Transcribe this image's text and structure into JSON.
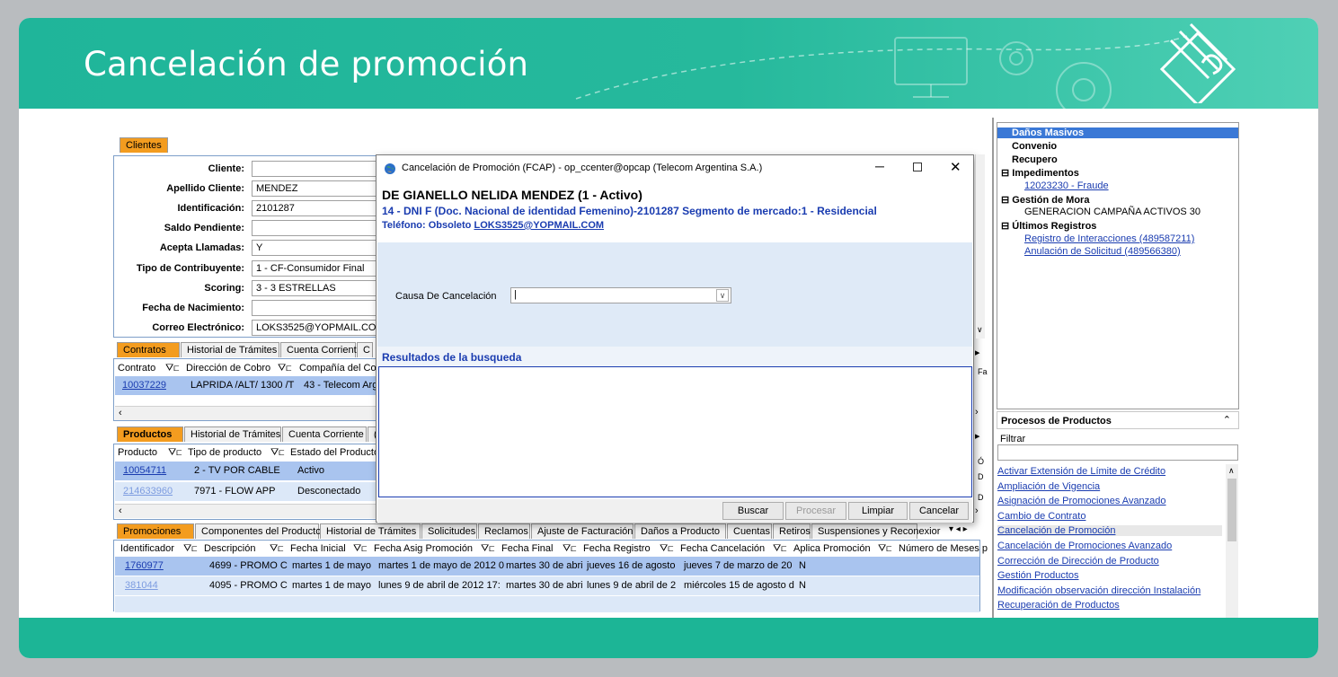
{
  "slide": {
    "title": "Cancelación de promoción"
  },
  "clientes_tab": "Clientes",
  "client_fields": [
    {
      "label": "Cliente:",
      "value": ""
    },
    {
      "label": "Apellido Cliente:",
      "value": "MENDEZ"
    },
    {
      "label": "Identificación:",
      "value": "2101287"
    },
    {
      "label": "Saldo Pendiente:",
      "value": ""
    },
    {
      "label": "Acepta Llamadas:",
      "value": "Y"
    },
    {
      "label": "Tipo de Contribuyente:",
      "value": "1 - CF-Consumidor Final"
    },
    {
      "label": "Scoring:",
      "value": "3 - 3 ESTRELLAS"
    },
    {
      "label": "Fecha de Nacimiento:",
      "value": ""
    },
    {
      "label": "Correo Electrónico:",
      "value": "LOKS3525@YOPMAIL.COM"
    }
  ],
  "contratos": {
    "tabs": [
      "Contratos",
      "Historial de Trámites",
      "Cuenta Corriente",
      "C"
    ],
    "headers": [
      "Contrato",
      "Dirección de Cobro",
      "Compañía del Cont"
    ],
    "row": {
      "contrato": "10037229",
      "direccion": "LAPRIDA /ALT/ 1300 /T",
      "compania": "43 - Telecom Arg"
    }
  },
  "productos": {
    "tabs": [
      "Productos",
      "Historial de Trámites",
      "Cuenta Corriente",
      "("
    ],
    "headers": [
      "Producto",
      "Tipo de producto",
      "Estado del Producto"
    ],
    "rows": [
      {
        "id": "10054711",
        "tipo": "2 - TV POR CABLE",
        "estado": "Activo"
      },
      {
        "id": "214633960",
        "tipo": "7971 - FLOW APP",
        "estado": "Desconectado"
      }
    ]
  },
  "promociones": {
    "tabs": [
      "Promociones",
      "Componentes del Producto",
      "Historial de Trámites",
      "Solicitudes",
      "Reclamos",
      "Ajuste de Facturación",
      "Daños a Producto",
      "Cuentas",
      "Retiros",
      "Suspensiones y Reconexior"
    ],
    "headers": [
      "Identificador",
      "Descripción",
      "Fecha Inicial",
      "Fecha Asig Promoción",
      "Fecha Final",
      "Fecha Registro",
      "Fecha Cancelación",
      "Aplica Promoción",
      "Número de Meses p"
    ],
    "rows": [
      {
        "id": "1760977",
        "desc": "4699 - PROMO C",
        "inicial": "martes 1 de mayo",
        "asig": "martes 1 de mayo de 2012 0",
        "final": "martes 30 de abri",
        "registro": "jueves 16 de agosto",
        "cancel": "jueves 7 de marzo de 20",
        "aplica": "N"
      },
      {
        "id": "381044",
        "desc": "4095 - PROMO C",
        "inicial": "martes 1 de mayo",
        "asig": "lunes 9 de abril de 2012 17:",
        "final": "martes 30 de abri",
        "registro": "lunes 9 de abril de 2",
        "cancel": "miércoles 15 de agosto d",
        "aplica": "N"
      }
    ]
  },
  "right_panel": {
    "items": [
      {
        "text": "Daños Masivos",
        "type": "selected"
      },
      {
        "text": "Convenio",
        "type": "bold"
      },
      {
        "text": "Recupero",
        "type": "bold"
      },
      {
        "text": "Impedimentos",
        "type": "group"
      },
      {
        "text": "12023230 - Fraude",
        "type": "link"
      },
      {
        "text": "Gestión de Mora",
        "type": "group"
      },
      {
        "text": "GENERACION CAMPAÑA ACTIVOS 30",
        "type": "plain"
      },
      {
        "text": "Últimos Registros",
        "type": "group"
      },
      {
        "text": "Registro de Interacciones (489587211)",
        "type": "link"
      },
      {
        "text": "Anulación de Solicitud (489566380)",
        "type": "link"
      }
    ],
    "procesos_title": "Procesos de Productos",
    "filtrar_label": "Filtrar",
    "procesos": [
      "Activar Extensión de Límite de Crédito",
      "Ampliación de Vigencia",
      "Asignación de Promociones Avanzado",
      "Cambio de Contrato",
      "Cancelación de Promoción",
      "Cancelación de Promociones Avanzado",
      "Corrección de Dirección de Producto",
      "Gestión Productos",
      "Modificación observación dirección Instalación",
      "Recuperación de Productos"
    ]
  },
  "dialog": {
    "title": "Cancelación de Promoción (FCAP) - op_ccenter@opcap (Telecom Argentina S.A.)",
    "customer_name": "DE GIANELLO NELIDA  MENDEZ (1 - Activo)",
    "customer_info": "14 - DNI F (Doc. Nacional de identidad Femenino)-2101287 Segmento de mercado:1 - Residencial",
    "telefono_label": "Teléfono: Obsoleto",
    "email": "LOKS3525@YOPMAIL.COM",
    "causa_label": "Causa De Cancelación",
    "causa_value": "",
    "resultados_label": "Resultados de la busqueda",
    "buttons": {
      "buscar": "Buscar",
      "procesar": "Procesar",
      "limpiar": "Limpiar",
      "cancelar": "Cancelar"
    }
  }
}
